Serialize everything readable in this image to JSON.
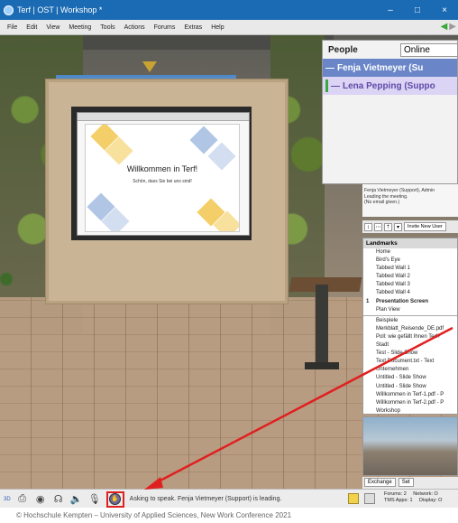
{
  "window": {
    "title": "Terf | OST | Workshop *",
    "controls": {
      "minimize": "–",
      "maximize": "□",
      "close": "×"
    }
  },
  "menu": [
    "File",
    "Edit",
    "View",
    "Meeting",
    "Tools",
    "Actions",
    "Forums",
    "Extras",
    "Help"
  ],
  "slide": {
    "title": "Willkommen in Terf!",
    "subtitle": "Schön, dass Sie bei uns sind!"
  },
  "people": {
    "header": "People",
    "filter": "Online",
    "users": [
      {
        "name": "Fenja Vietmeyer (Su",
        "selected": true
      },
      {
        "name": "Lena Pepping (Suppo",
        "selected": false
      }
    ]
  },
  "info": {
    "lines": [
      "Fenja Vietmeyer (Support), Admin",
      "Leading the meeting.",
      "(No email given.)"
    ]
  },
  "invite_button": "Invite New User",
  "landmarks": {
    "header": "Landmarks",
    "places": [
      {
        "label": "Home"
      },
      {
        "label": "Bird's Eye"
      },
      {
        "label": "Tabbed Wall 1"
      },
      {
        "label": "Tabbed Wall 2"
      },
      {
        "label": "Tabbed Wall 3"
      },
      {
        "label": "Tabbed Wall 4"
      },
      {
        "label": "Presentation Screen",
        "bold": true,
        "num": "1"
      },
      {
        "label": "Plan View"
      }
    ],
    "items": [
      "Beispiele",
      "Merkblatt_Reisende_DE.pdf",
      "Poll: wie gefällt Ihnen Terf?",
      "Stadt",
      "Test - Slide Show",
      "Text Document.txt - Text",
      "Unternehmen",
      "Untitled - Slide Show",
      "Untitled - Slide Show",
      "Willkommen in Terf-1.pdf - P",
      "Willkommen in Terf-2.pdf - P",
      "Workshop"
    ]
  },
  "exchange_tabs": [
    "Exchange",
    "Set"
  ],
  "status": {
    "volume_label": "3D",
    "message": "Asking to speak. Fenja Vietmeyer (Support) is leading.",
    "forums": "Forums:",
    "forums_count": "2",
    "tms": "TMS Apps:",
    "tms_count": "1",
    "network": "Network: O",
    "display": "Display: O"
  },
  "footer": "© Hochschule Kempten – University of Applied Sciences, New Work Conference 2021",
  "colors": {
    "titlebar": "#1b6bb4",
    "highlight_box": "#e02020",
    "selected_user": "#6a86c8"
  }
}
